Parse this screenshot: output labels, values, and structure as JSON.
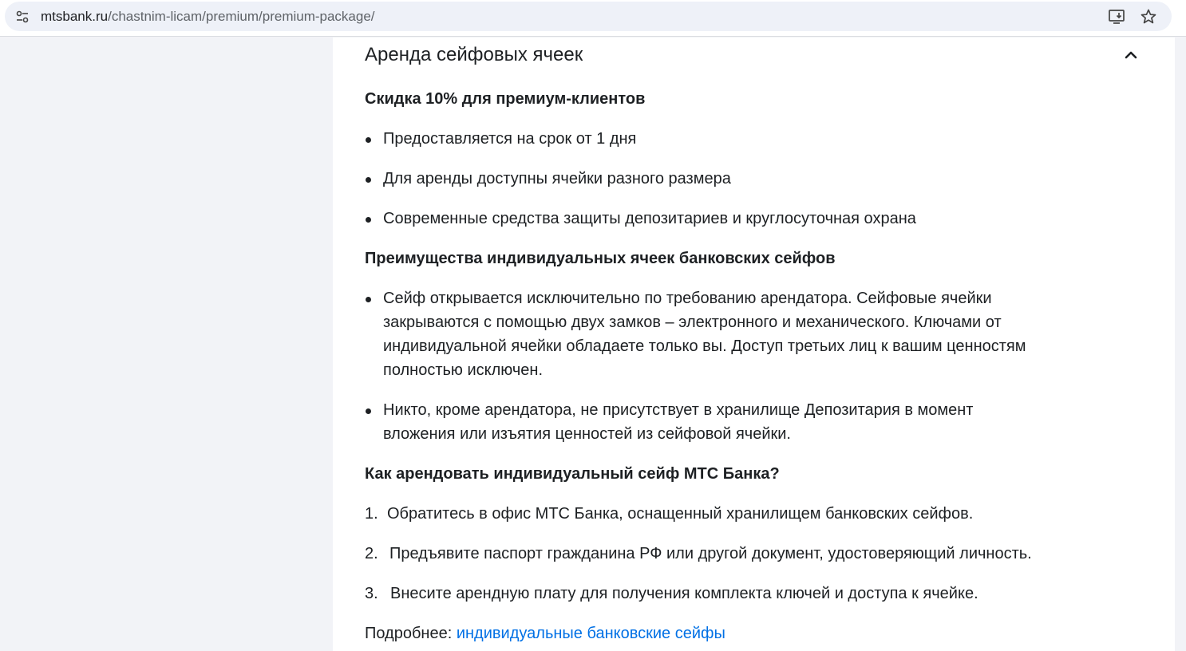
{
  "browser": {
    "url_host": "mtsbank.ru",
    "url_path": "/chastnim-licam/premium/premium-package/",
    "icons": [
      "site-info-icon",
      "install-app-icon",
      "bookmark-star-icon"
    ]
  },
  "accordion": {
    "title": "Аренда сейфовых ячеек",
    "toggle_icon": "chevron-up-icon"
  },
  "discount": {
    "heading": "Скидка 10% для премиум-клиентов",
    "items": [
      "Предоставляется на срок от 1 дня",
      "Для аренды доступны ячейки разного размера",
      "Современные средства защиты депозитариев и круглосуточная охрана"
    ]
  },
  "advantages": {
    "heading": "Преимущества индивидуальных ячеек банковских сейфов",
    "items": [
      "Сейф открывается исключительно по требованию арендатора. Сейфовые ячейки\nзакрываются с помощью двух замков – электронного и механического. Ключами от\nиндивидуальной ячейки обладаете только вы. Доступ третьих лиц к вашим ценностям\nполностью исключен.",
      "Никто, кроме арендатора, не присутствует в хранилище Депозитария в момент\nвложения или изъятия ценностей из сейфовой ячейки."
    ]
  },
  "howto": {
    "heading": "Как арендовать индивидуальный сейф МТС Банка?",
    "steps": [
      {
        "n": "1.",
        "text": "Обратитесь в офис МТС Банка, оснащенный хранилищем банковских сейфов."
      },
      {
        "n": "2.",
        "text": "Предъявите паспорт гражданина РФ или другой документ, удостоверяющий личность."
      },
      {
        "n": "3.",
        "text": "Внесите арендную плату для получения комплекта ключей и доступа к ячейке."
      }
    ]
  },
  "more": {
    "label": "Подробнее: ",
    "link_text": "индивидуальные банковские сейфы",
    "link_color": "#0070e5"
  }
}
